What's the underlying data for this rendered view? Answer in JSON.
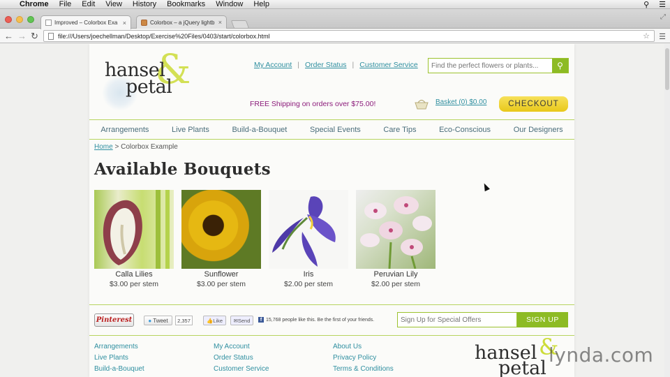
{
  "os_menu": {
    "app": "Chrome",
    "items": [
      "File",
      "Edit",
      "View",
      "History",
      "Bookmarks",
      "Window",
      "Help"
    ]
  },
  "tabs": [
    {
      "label": "Improved – Colorbox Exa",
      "close": "×"
    },
    {
      "label": "Colorbox – a jQuery lightb",
      "close": "×"
    }
  ],
  "address_bar": {
    "url": "file:///Users/joechellman/Desktop/Exercise%20Files/0403/start/colorbox.html"
  },
  "site": {
    "logo": {
      "word1": "hansel",
      "amp": "&",
      "word2": "petal"
    },
    "top_links": [
      "My Account",
      "Order Status",
      "Customer Service"
    ],
    "top_links_sep": "|",
    "search_placeholder": "Find the perfect flowers or plants...",
    "shipping_text": "FREE Shipping on orders over $75.00!",
    "basket_text": "Basket (0) $0.00",
    "checkout_label": "CHECKOUT",
    "nav": [
      "Arrangements",
      "Live Plants",
      "Build-a-Bouquet",
      "Special Events",
      "Care Tips",
      "Eco-Conscious",
      "Our Designers"
    ],
    "breadcrumb": {
      "home": "Home",
      "sep": ">",
      "current": "Colorbox Example"
    },
    "page_title": "Available Bouquets",
    "products": [
      {
        "name": "Calla Lilies",
        "price": "$3.00 per stem"
      },
      {
        "name": "Sunflower",
        "price": "$3.00 per stem"
      },
      {
        "name": "Iris",
        "price": "$2.00 per stem"
      },
      {
        "name": "Peruvian Lily",
        "price": "$2.00 per stem"
      }
    ],
    "social": {
      "pinterest": "Pinterest",
      "tweet": "Tweet",
      "tweet_count": "2,357",
      "like": "Like",
      "send": "Send",
      "fb_text": "15,768 people like this. Be the first of your friends."
    },
    "signup_placeholder": "Sign Up for Special Offers",
    "signup_button": "SIGN UP",
    "footer": {
      "col1": [
        "Arrangements",
        "Live Plants",
        "Build-a-Bouquet"
      ],
      "col2": [
        "My Account",
        "Order Status",
        "Customer Service"
      ],
      "col3": [
        "About Us",
        "Privacy Policy",
        "Terms & Conditions"
      ]
    }
  },
  "watermark": {
    "lynda": "lynda.com"
  },
  "colors": {
    "accent_green": "#8dbb24",
    "link_teal": "#2f8fa0",
    "promo_purple": "#8b1a7a",
    "checkout_yellow": "#f0d230"
  }
}
